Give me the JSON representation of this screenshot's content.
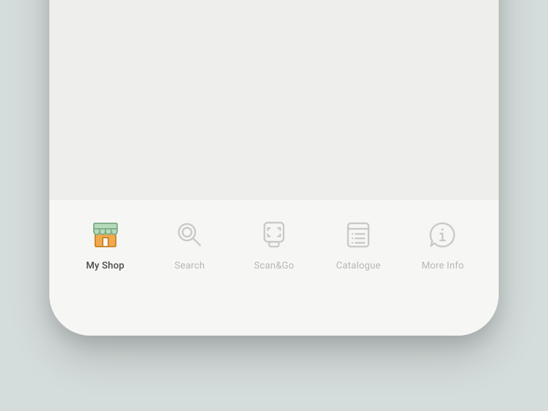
{
  "tabbar": {
    "items": [
      {
        "label": "My Shop",
        "icon": "shop-icon",
        "active": true
      },
      {
        "label": "Search",
        "icon": "search-icon",
        "active": false
      },
      {
        "label": "Scan&Go",
        "icon": "scan-icon",
        "active": false
      },
      {
        "label": "Catalogue",
        "icon": "catalogue-icon",
        "active": false
      },
      {
        "label": "More Info",
        "icon": "info-icon",
        "active": false
      }
    ]
  },
  "colors": {
    "inactive": "#c9c9c5",
    "activeText": "#4a4a47",
    "shopRoof": "#b6dbbc",
    "shopRoofStroke": "#7fae87",
    "shopWall": "#f2a94c",
    "shopWallStroke": "#c9862f",
    "shopDoor": "#ffffff"
  }
}
